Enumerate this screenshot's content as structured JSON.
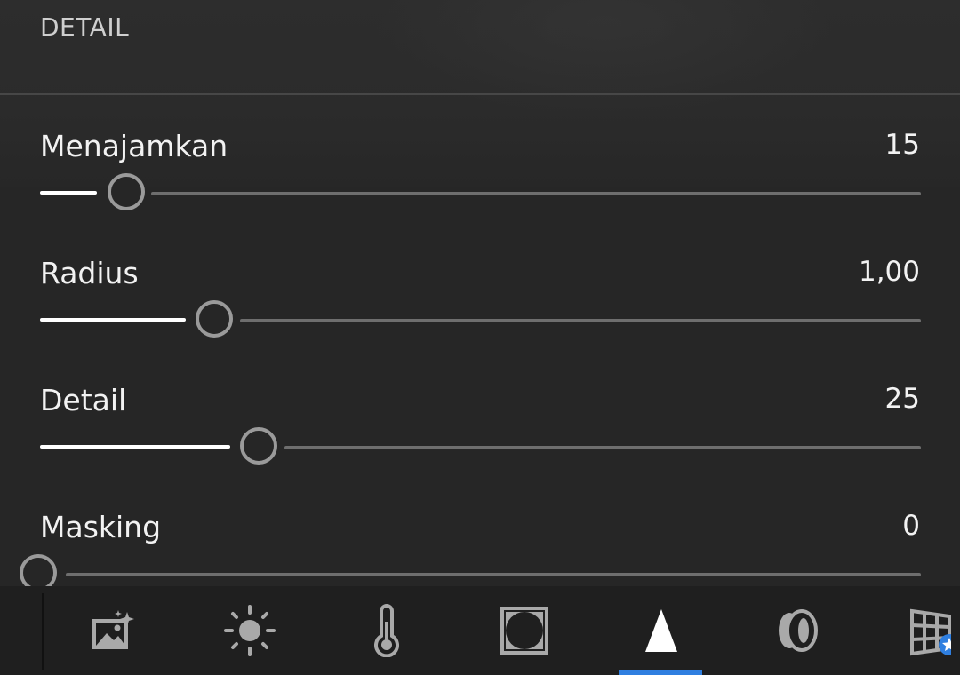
{
  "section": {
    "title": "DETAIL"
  },
  "sliders": [
    {
      "id": "sharpen",
      "label": "Menajamkan",
      "value": "15",
      "fraction": 0.1
    },
    {
      "id": "radius",
      "label": "Radius",
      "value": "1,00",
      "fraction": 0.2
    },
    {
      "id": "detail",
      "label": "Detail",
      "value": "25",
      "fraction": 0.25
    },
    {
      "id": "masking",
      "label": "Masking",
      "value": "0",
      "fraction": 0.0
    }
  ],
  "toolbar": {
    "tools": [
      {
        "icon": "auto-enhance-image-icon"
      },
      {
        "icon": "sun-light-icon"
      },
      {
        "icon": "thermometer-color-icon"
      },
      {
        "icon": "vignette-effects-icon"
      },
      {
        "icon": "detail-sharpen-icon",
        "active": true
      },
      {
        "icon": "optics-lens-icon"
      },
      {
        "icon": "geometry-grid-premium-icon"
      }
    ],
    "accent_color": "#2f7fe0"
  }
}
